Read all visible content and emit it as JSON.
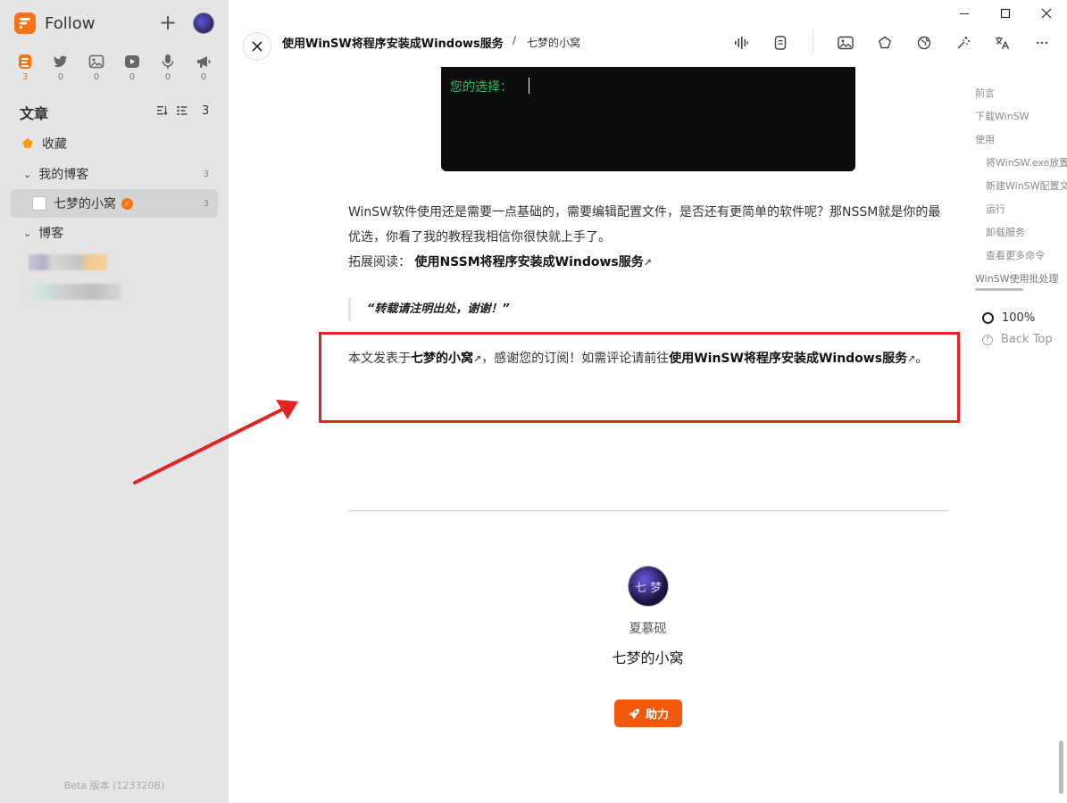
{
  "app": {
    "name": "Follow",
    "version": "Beta 版本 (123320B)"
  },
  "views": [
    {
      "icon": "article-icon",
      "count": "3"
    },
    {
      "icon": "twitter-icon",
      "count": "0"
    },
    {
      "icon": "image-icon",
      "count": "0"
    },
    {
      "icon": "video-icon",
      "count": "0"
    },
    {
      "icon": "microphone-icon",
      "count": "0"
    },
    {
      "icon": "megaphone-icon",
      "count": "0"
    }
  ],
  "sidebar": {
    "section_title": "文章",
    "section_count": "3",
    "favorites": "收藏",
    "category_my_blog": {
      "label": "我的博客",
      "count": "3"
    },
    "site": {
      "label": "七梦的小窝",
      "count": "3"
    },
    "category_blog": {
      "label": "博客"
    }
  },
  "header": {
    "title": "使用WinSW将程序安装成Windows服务",
    "separator": "/",
    "site": "七梦的小窝"
  },
  "article": {
    "code_prompt": "您的选择：",
    "p1_text": "WinSW软件使用还是需要一点基础的，需要编辑配置文件，是否还有更简单的软件呢？那NSSM就是你的最优选，你看了我的教程我相信你很快就上手了。",
    "p1_ext_label": "拓展阅读：",
    "p1_ext_link": "使用NSSM将程序安装成Windows服务",
    "quote": "“转载请注明出处，谢谢！”",
    "p2_prefix": "本文发表于",
    "p2_site_link": "七梦的小窝",
    "p2_middle": "，感谢您的订阅！如需评论请前往",
    "p2_article_link": "使用WinSW将程序安装成Windows服务",
    "p2_suffix": "。",
    "ext_arrow": "↗"
  },
  "author": {
    "avatar_text": "七 梦",
    "name": "夏慕砚",
    "site": "七梦的小窝",
    "boost_label": "助力"
  },
  "toc": {
    "items": [
      "前言",
      "下载WinSW",
      "使用",
      "将WinSW.exe放置",
      "新建WinSW配置文",
      "运行",
      "卸载服务",
      "查看更多命令",
      "WinSW使用批处理"
    ],
    "progress": "100%",
    "back_top": "Back Top"
  },
  "colors": {
    "accent": "#f97316",
    "annotation": "#e52222",
    "code_text": "#22c55e"
  }
}
